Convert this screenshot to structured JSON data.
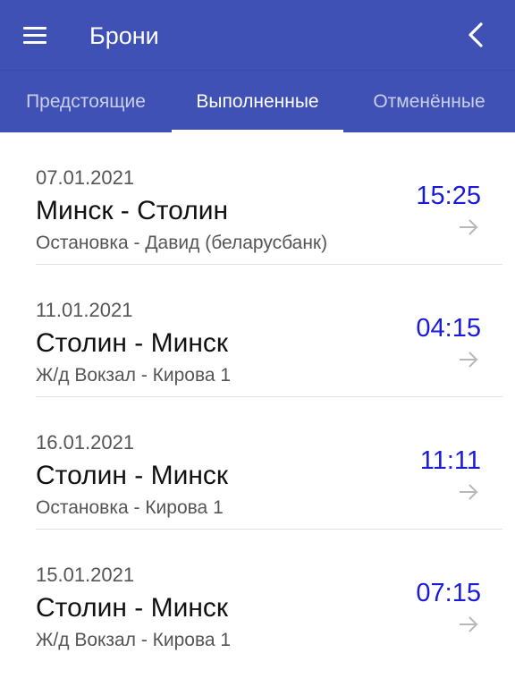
{
  "appbar": {
    "title": "Брони",
    "menu_icon": "hamburger-menu-icon",
    "back_icon": "chevron-left-icon"
  },
  "tabs": [
    {
      "label": "Предстоящие",
      "active": false
    },
    {
      "label": "Выполненные",
      "active": true
    },
    {
      "label": "Отменённые",
      "active": false
    }
  ],
  "bookings": [
    {
      "date": "07.01.2021",
      "route": "Минск - Столин",
      "stops": "Остановка - Давид (беларусбанк)",
      "time": "15:25"
    },
    {
      "date": "11.01.2021",
      "route": "Столин - Минск",
      "stops": "Ж/д Вокзал - Кирова 1",
      "time": "04:15"
    },
    {
      "date": "16.01.2021",
      "route": "Столин - Минск",
      "stops": "Остановка - Кирова 1",
      "time": "11:11"
    },
    {
      "date": "15.01.2021",
      "route": "Столин - Минск",
      "stops": "Ж/д Вокзал - Кирова 1",
      "time": "07:15"
    }
  ],
  "colors": {
    "primary": "#3f51b5",
    "time_accent": "#1a1ad8",
    "divider": "#e2e2e2"
  }
}
